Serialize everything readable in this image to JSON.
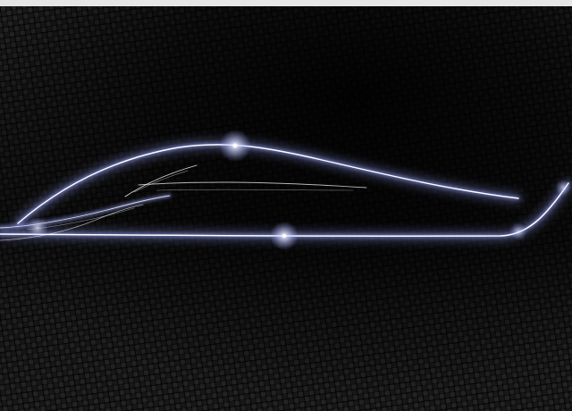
{
  "scene": {
    "subject": "light-trail-car-silhouette",
    "texture": "carbon-fiber-weave"
  },
  "colors": {
    "top_bar": "#e6e6e6",
    "background": "#050505",
    "fiber_light": "#3a3a3c",
    "fiber_dark": "#0c0c0d",
    "light_core": "#ffffff",
    "light_glow": "#9aa6ff"
  }
}
